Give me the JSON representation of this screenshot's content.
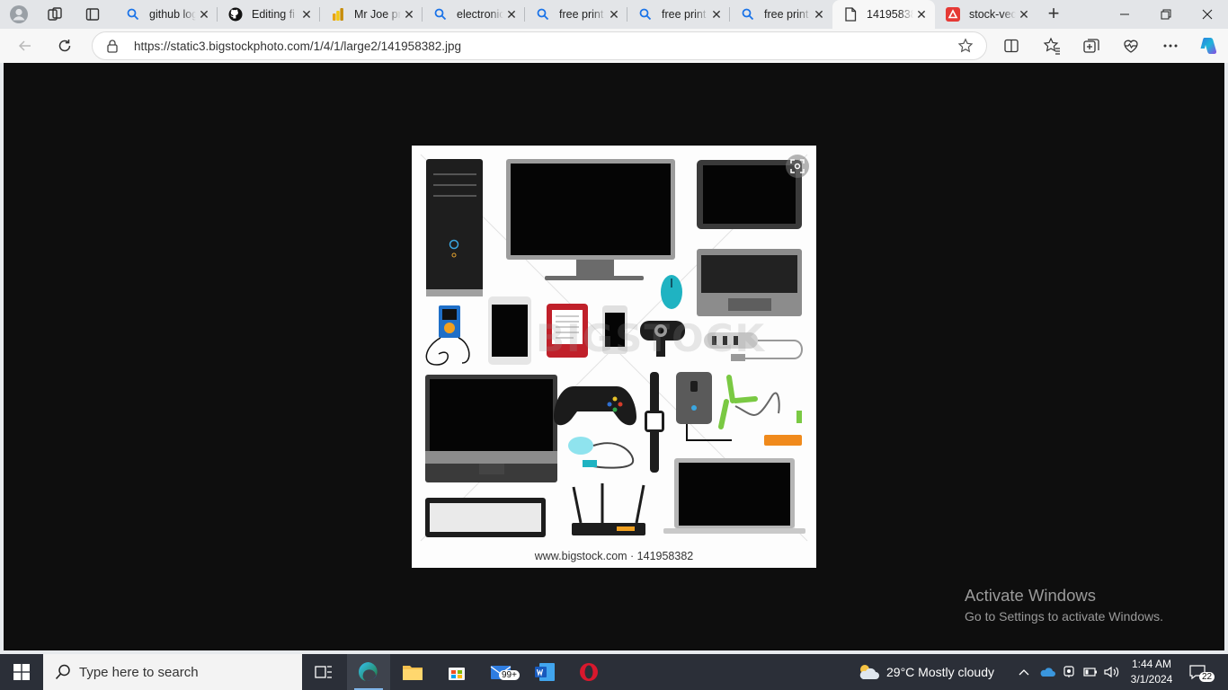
{
  "tabs": [
    {
      "title": "github log",
      "icon": "search-icon"
    },
    {
      "title": "Editing fi",
      "icon": "github-icon"
    },
    {
      "title": "Mr Joe pr",
      "icon": "powerbi-icon"
    },
    {
      "title": "electronic",
      "icon": "search-icon"
    },
    {
      "title": "free print",
      "icon": "search-icon"
    },
    {
      "title": "free print",
      "icon": "search-icon"
    },
    {
      "title": "free print",
      "icon": "search-icon"
    },
    {
      "title": "141958382",
      "icon": "page-icon",
      "active": true
    },
    {
      "title": "stock-vec",
      "icon": "bigstock-icon"
    }
  ],
  "address": {
    "url": "https://static3.bigstockphoto.com/1/4/1/large2/141958382.jpg"
  },
  "image": {
    "watermark": "BIGSTOCK",
    "credit": "www.bigstock.com · 141958382"
  },
  "activation": {
    "title": "Activate Windows",
    "subtitle": "Go to Settings to activate Windows."
  },
  "taskbar": {
    "search_placeholder": "Type here to search",
    "mail_badge": "99+",
    "weather": "29°C  Mostly cloudy",
    "time": "1:44 AM",
    "date": "3/1/2024",
    "notifications": "22"
  },
  "colors": {
    "accent": "#0078d4",
    "tabstrip": "#e3e5e8",
    "content_bg": "#0e0e0e",
    "taskbar": "#2b2f38"
  }
}
